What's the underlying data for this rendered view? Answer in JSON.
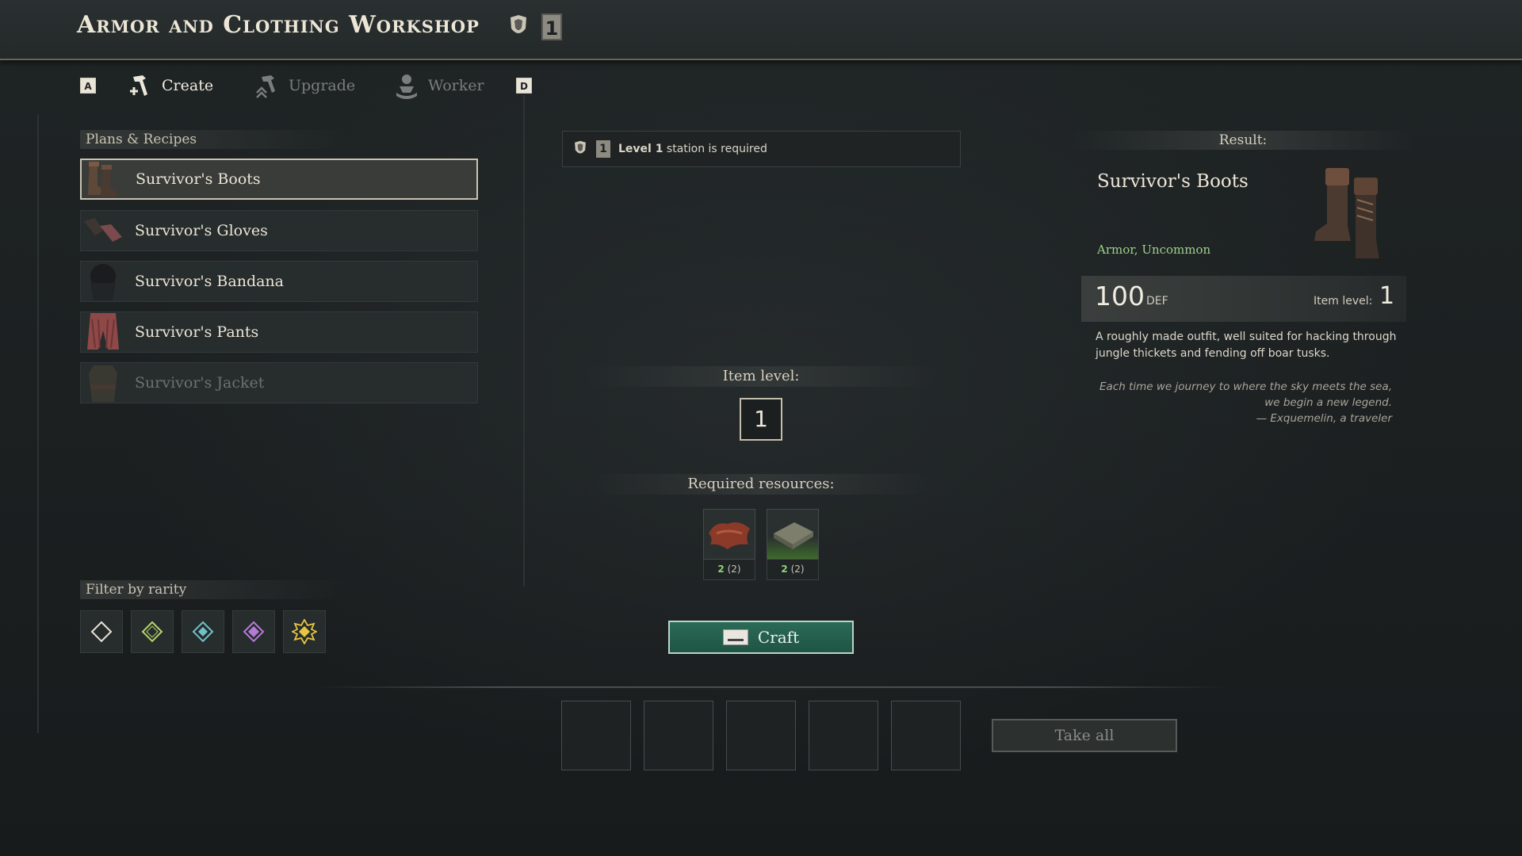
{
  "header": {
    "title": "Armor and Clothing Workshop",
    "station_level": "1"
  },
  "tabs": {
    "prev_key": "A",
    "next_key": "D",
    "items": [
      {
        "label": "Create",
        "active": true
      },
      {
        "label": "Upgrade",
        "active": false
      },
      {
        "label": "Worker",
        "active": false
      }
    ]
  },
  "recipes": {
    "header": "Plans & Recipes",
    "items": [
      {
        "name": "Survivor's Boots"
      },
      {
        "name": "Survivor's Gloves"
      },
      {
        "name": "Survivor's Bandana"
      },
      {
        "name": "Survivor's Pants"
      },
      {
        "name": "Survivor's Jacket"
      }
    ]
  },
  "filter": {
    "header": "Filter by rarity",
    "colors": [
      "#e8e4d8",
      "#b7d36a",
      "#6fc2c6",
      "#b57ad6",
      "#e6c542"
    ]
  },
  "requirement": {
    "level_label": "1",
    "level_text": "Level 1",
    "suffix": "station is required"
  },
  "item_level": {
    "label": "Item level:",
    "value": "1"
  },
  "resources": {
    "label": "Required resources:",
    "items": [
      {
        "have": "2",
        "need": "(2)"
      },
      {
        "have": "2",
        "need": "(2)"
      }
    ]
  },
  "craft": {
    "label": "Craft"
  },
  "take_all": {
    "label": "Take all"
  },
  "result": {
    "header": "Result:",
    "name": "Survivor's Boots",
    "type": "Armor, Uncommon",
    "stat_value": "100",
    "stat_unit": "DEF",
    "item_level_label": "Item level:",
    "item_level_value": "1",
    "description": "A roughly made outfit, well suited for hacking through jungle thickets and fending off boar tusks.",
    "quote": [
      "Each time we journey to where the sky meets the sea,",
      "we begin a new legend.",
      "— Exquemelin, a traveler"
    ]
  }
}
